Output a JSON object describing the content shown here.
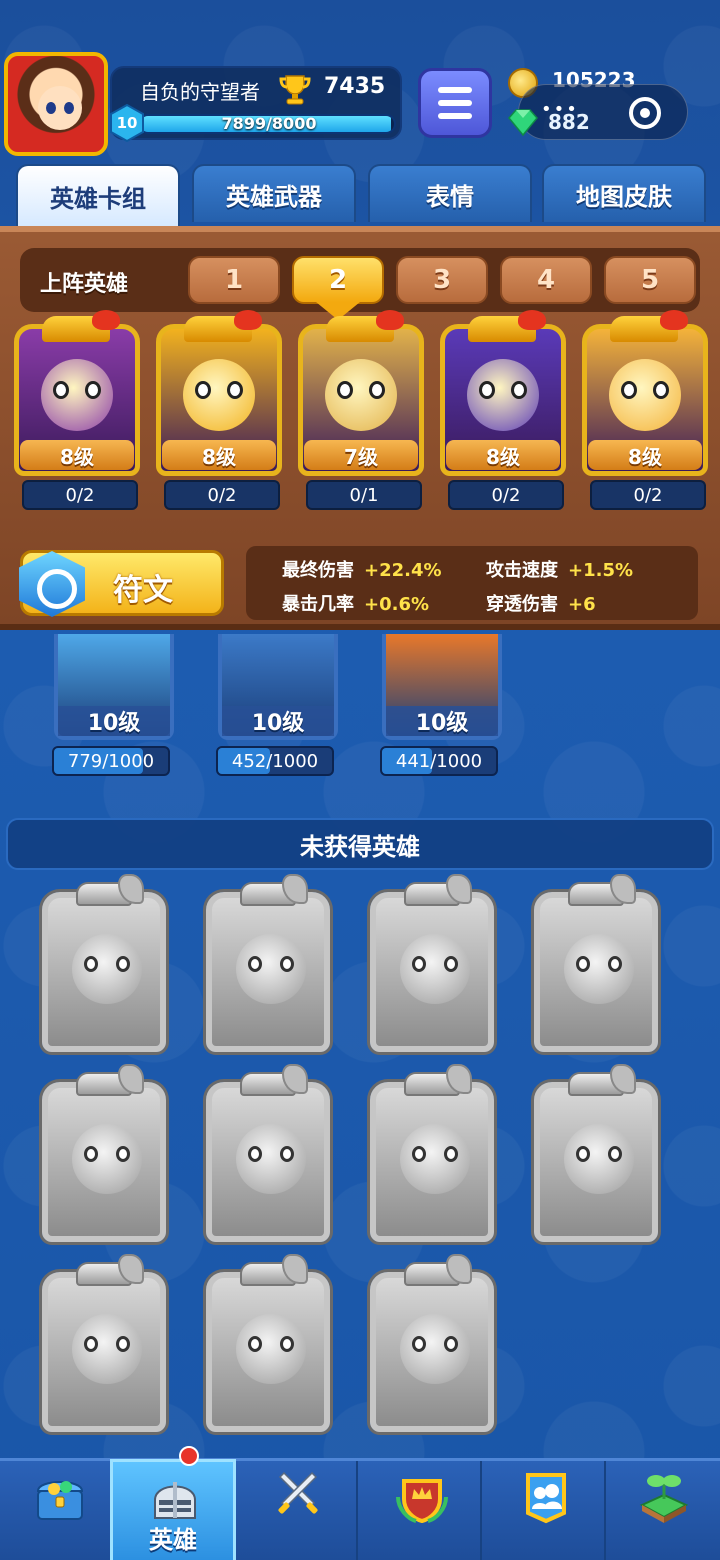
{
  "player": {
    "name": "自负的守望者",
    "trophies": "7435",
    "level": "10",
    "xp_text": "7899/8000",
    "xp_fraction": 0.987
  },
  "currency": {
    "coins": "105223",
    "gems": "882"
  },
  "tabs": [
    {
      "label": "英雄卡组",
      "active": true
    },
    {
      "label": "英雄武器",
      "active": false
    },
    {
      "label": "表情",
      "active": false
    },
    {
      "label": "地图皮肤",
      "active": false
    }
  ],
  "lineup": {
    "label": "上阵英雄",
    "slots": [
      "1",
      "2",
      "3",
      "4",
      "5"
    ],
    "active_slot": "2"
  },
  "deck_heroes": [
    {
      "level": "8级",
      "progress": "0/2",
      "color": "#8a3ca8"
    },
    {
      "level": "8级",
      "progress": "0/2",
      "color": "#f2b21e"
    },
    {
      "level": "7级",
      "progress": "0/1",
      "color": "#e2b24a"
    },
    {
      "level": "8级",
      "progress": "0/2",
      "color": "#5a3ab8"
    },
    {
      "level": "8级",
      "progress": "0/2",
      "color": "#f4b33a"
    }
  ],
  "rune": {
    "label": "符文"
  },
  "stats": [
    {
      "name": "最终伤害",
      "value": "+22.4%"
    },
    {
      "name": "攻击速度",
      "value": "+1.5%"
    },
    {
      "name": "暴击几率",
      "value": "+0.6%"
    },
    {
      "name": "穿透伤害",
      "value": "+6"
    }
  ],
  "owned_heroes": [
    {
      "level": "10级",
      "progress": "779/1000",
      "fraction": 0.779,
      "color": "#4fa8e8"
    },
    {
      "level": "10级",
      "progress": "452/1000",
      "fraction": 0.452,
      "color": "#3c7ac8"
    },
    {
      "level": "10级",
      "progress": "441/1000",
      "fraction": 0.441,
      "color": "#e8782a"
    }
  ],
  "not_obtained": {
    "title": "未获得英雄",
    "count": 11
  },
  "bottom_nav": [
    {
      "icon": "treasure-chest-icon",
      "label": "",
      "active": false
    },
    {
      "icon": "knight-helmet-icon",
      "label": "英雄",
      "active": true
    },
    {
      "icon": "crossed-swords-icon",
      "label": "",
      "active": false
    },
    {
      "icon": "crown-shield-icon",
      "label": "",
      "active": false
    },
    {
      "icon": "team-banner-icon",
      "label": "",
      "active": false
    },
    {
      "icon": "sprout-island-icon",
      "label": "",
      "active": false
    }
  ]
}
